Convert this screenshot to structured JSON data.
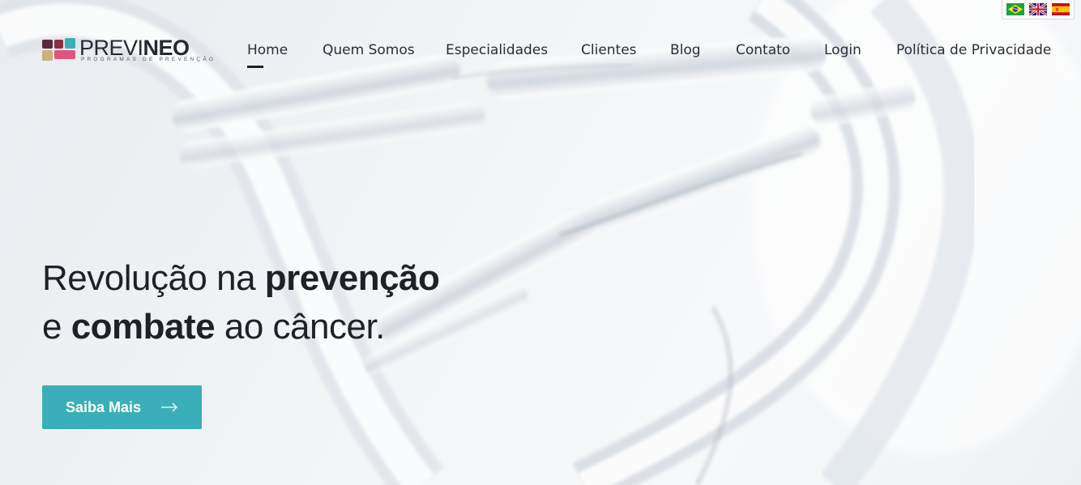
{
  "brand": {
    "name_light": "PREVI",
    "name_bold": "NEO",
    "tagline": "PROGRAMAS DE PREVENÇÃO",
    "logo_colors": [
      "#5a2a3a",
      "#3aafb9",
      "#c9b37a",
      "#e0547d"
    ]
  },
  "languages": [
    {
      "code": "pt-BR",
      "icon": "brazil-flag-icon"
    },
    {
      "code": "en-GB",
      "icon": "uk-flag-icon"
    },
    {
      "code": "es",
      "icon": "spain-flag-icon"
    }
  ],
  "nav": {
    "active": "Home",
    "items": [
      {
        "label": "Home"
      },
      {
        "label": "Quem Somos"
      },
      {
        "label": "Especialidades"
      },
      {
        "label": "Clientes"
      },
      {
        "label": "Blog"
      },
      {
        "label": "Contato"
      },
      {
        "label": "Login"
      },
      {
        "label": "Política de Privacidade"
      }
    ]
  },
  "hero": {
    "line1_thin": "Revolução na ",
    "line1_bold": "prevenção",
    "line2_thin_a": "e ",
    "line2_bold": "combate",
    "line2_thin_b": " ao câncer.",
    "cta_label": "Saiba Mais",
    "cta_icon": "arrow-right-icon",
    "cta_color": "#3aafb9"
  }
}
